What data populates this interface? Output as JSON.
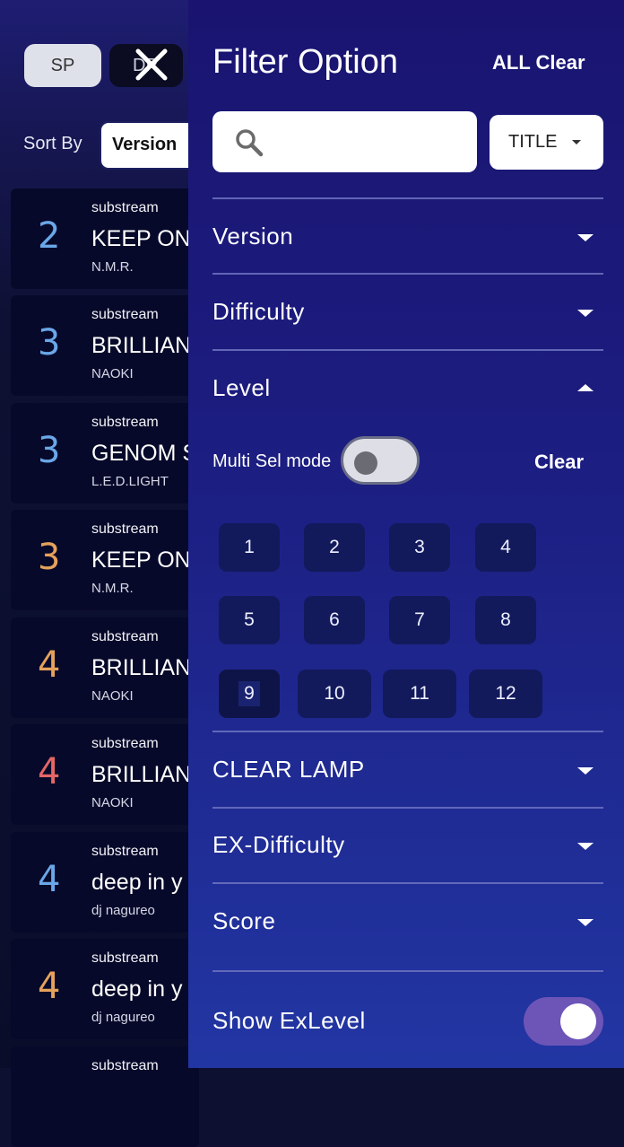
{
  "background": {
    "modes": {
      "sp": "SP",
      "dp": "DP"
    },
    "sort": {
      "label": "Sort By",
      "value": "Version"
    },
    "songs": [
      {
        "level": "2",
        "level_color": "#6aa7e8",
        "version": "substream",
        "title": "KEEP ON",
        "artist": "N.M.R."
      },
      {
        "level": "3",
        "level_color": "#6aa7e8",
        "version": "substream",
        "title": "BRILLIAN",
        "artist": "NAOKI"
      },
      {
        "level": "3",
        "level_color": "#6aa7e8",
        "version": "substream",
        "title": "GENOM S",
        "artist": "L.E.D.LIGHT"
      },
      {
        "level": "3",
        "level_color": "#e5a15b",
        "version": "substream",
        "title": "KEEP ON",
        "artist": "N.M.R."
      },
      {
        "level": "4",
        "level_color": "#e5a15b",
        "version": "substream",
        "title": "BRILLIAN",
        "artist": "NAOKI"
      },
      {
        "level": "4",
        "level_color": "#e56666",
        "version": "substream",
        "title": "BRILLIAN",
        "artist": "NAOKI"
      },
      {
        "level": "4",
        "level_color": "#6aa7e8",
        "version": "substream",
        "title": "deep in y",
        "artist": "dj nagureo"
      },
      {
        "level": "4",
        "level_color": "#e5a15b",
        "version": "substream",
        "title": "deep in y",
        "artist": "dj nagureo"
      },
      {
        "level": "",
        "level_color": "#6aa7e8",
        "version": "substream",
        "title": "",
        "artist": ""
      }
    ]
  },
  "drawer": {
    "title": "Filter Option",
    "all_clear": "ALL Clear",
    "search": {
      "value": "",
      "placeholder": ""
    },
    "field_select": "TITLE",
    "sections": {
      "version": "Version",
      "difficulty": "Difficulty",
      "level": "Level",
      "clear_lamp": "CLEAR LAMP",
      "ex_difficulty": "EX-Difficulty",
      "score": "Score"
    },
    "level_panel": {
      "multi_sel_label": "Multi Sel mode",
      "multi_sel_on": false,
      "clear": "Clear",
      "levels": [
        "1",
        "2",
        "3",
        "4",
        "5",
        "6",
        "7",
        "8",
        "9",
        "10",
        "11",
        "12"
      ],
      "focused_level": "9"
    },
    "show_exlevel": {
      "label": "Show ExLevel",
      "on": true
    }
  },
  "colors": {
    "drawer_top": "#1a1470",
    "drawer_bottom": "#2236a3",
    "toggle_on": "#6d55b8",
    "level_button": "#121a5c"
  }
}
